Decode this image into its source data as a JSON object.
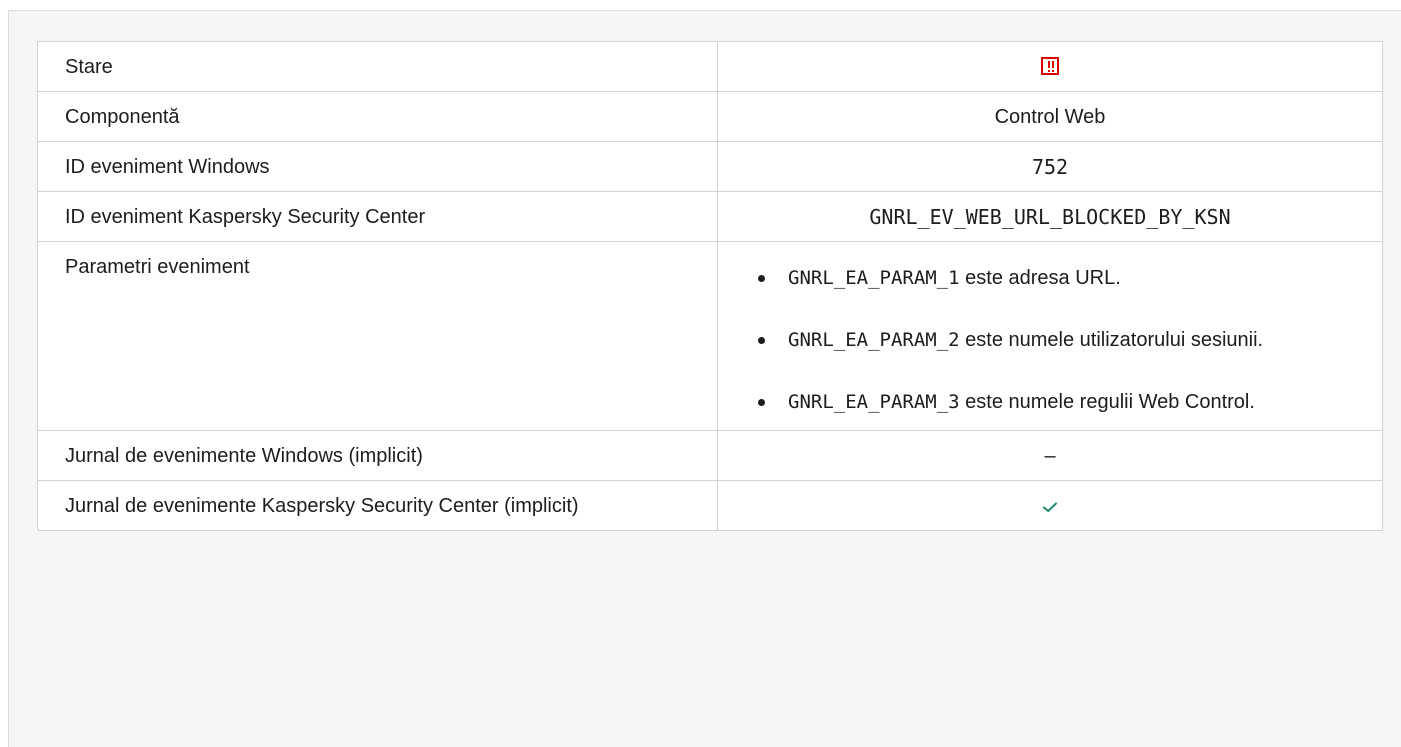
{
  "table": {
    "rows": [
      {
        "label": "Stare",
        "icon": "warning-square-icon",
        "icon_color": "#d90000"
      },
      {
        "label": "Componentă",
        "value": "Control Web"
      },
      {
        "label": "ID eveniment Windows",
        "value": "752"
      },
      {
        "label": "ID eveniment Kaspersky Security Center",
        "value": "GNRL_EV_WEB_URL_BLOCKED_BY_KSN"
      },
      {
        "label": "Parametri eveniment"
      },
      {
        "label": "Jurnal de evenimente Windows (implicit)",
        "value": "–"
      },
      {
        "label": "Jurnal de evenimente Kaspersky Security Center (implicit)",
        "icon": "checkmark-icon",
        "icon_color": "#1e8a6e"
      }
    ],
    "params": [
      {
        "code": "GNRL_EA_PARAM_1",
        "text": " este adresa URL."
      },
      {
        "code": "GNRL_EA_PARAM_2",
        "text": " este numele utilizatorului sesiunii."
      },
      {
        "code": "GNRL_EA_PARAM_3",
        "text": " este numele regulii Web Control."
      }
    ]
  }
}
